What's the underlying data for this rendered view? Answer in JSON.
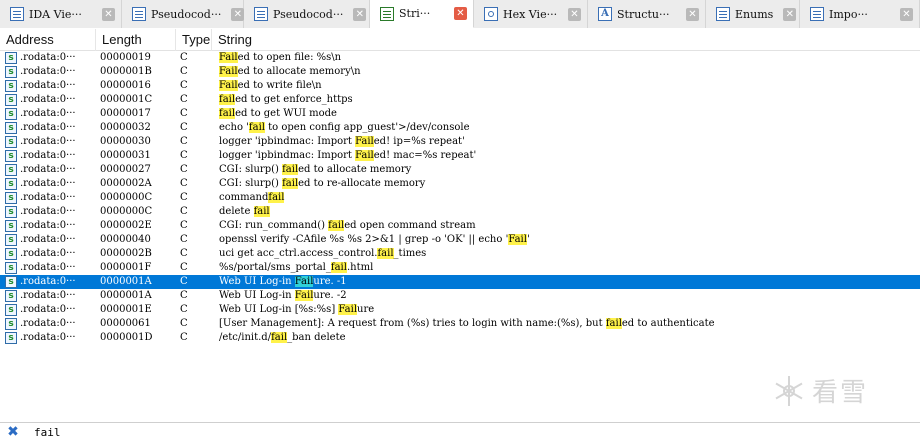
{
  "tabs": [
    {
      "label": "IDA Vie···",
      "icon": "ida-view-icon",
      "active": false
    },
    {
      "label": "Pseudocod···",
      "icon": "pseudocode-icon",
      "active": false
    },
    {
      "label": "Pseudocod···",
      "icon": "pseudocode-icon",
      "active": false
    },
    {
      "label": "Stri···",
      "icon": "strings-icon",
      "active": true
    },
    {
      "label": "Hex Vie···",
      "icon": "hex-view-icon",
      "active": false
    },
    {
      "label": "Structu···",
      "icon": "structures-icon",
      "active": false
    },
    {
      "label": "Enums",
      "icon": "enums-icon",
      "active": false
    },
    {
      "label": "Impo···",
      "icon": "imports-icon",
      "active": false
    }
  ],
  "columns": [
    "Address",
    "Length",
    "Type",
    "String"
  ],
  "rows": [
    {
      "address": ".rodata:0···",
      "length": "00000019",
      "type": "C",
      "pre": "",
      "match": "Fail",
      "post": "ed to open file: %s\\n"
    },
    {
      "address": ".rodata:0···",
      "length": "0000001B",
      "type": "C",
      "pre": "",
      "match": "Fail",
      "post": "ed to allocate memory\\n"
    },
    {
      "address": ".rodata:0···",
      "length": "00000016",
      "type": "C",
      "pre": "",
      "match": "Fail",
      "post": "ed to write file\\n"
    },
    {
      "address": ".rodata:0···",
      "length": "0000001C",
      "type": "C",
      "pre": "",
      "match": "fail",
      "post": "ed to get enforce_https"
    },
    {
      "address": ".rodata:0···",
      "length": "00000017",
      "type": "C",
      "pre": "",
      "match": "fail",
      "post": "ed to get WUI mode"
    },
    {
      "address": ".rodata:0···",
      "length": "00000032",
      "type": "C",
      "pre": "echo '",
      "match": "fail",
      "post": " to open config app_guest'>/dev/console"
    },
    {
      "address": ".rodata:0···",
      "length": "00000030",
      "type": "C",
      "pre": "logger 'ipbindmac: Import ",
      "match": "Fail",
      "post": "ed! ip=%s repeat'"
    },
    {
      "address": ".rodata:0···",
      "length": "00000031",
      "type": "C",
      "pre": "logger 'ipbindmac: Import ",
      "match": "Fail",
      "post": "ed! mac=%s repeat'"
    },
    {
      "address": ".rodata:0···",
      "length": "00000027",
      "type": "C",
      "pre": "CGI: slurp() ",
      "match": "fail",
      "post": "ed to allocate memory"
    },
    {
      "address": ".rodata:0···",
      "length": "0000002A",
      "type": "C",
      "pre": "CGI: slurp() ",
      "match": "fail",
      "post": "ed to re-allocate memory"
    },
    {
      "address": ".rodata:0···",
      "length": "0000000C",
      "type": "C",
      "pre": "command",
      "match": "fail",
      "post": ""
    },
    {
      "address": ".rodata:0···",
      "length": "0000000C",
      "type": "C",
      "pre": "delete ",
      "match": "fail",
      "post": ""
    },
    {
      "address": ".rodata:0···",
      "length": "0000002E",
      "type": "C",
      "pre": "CGI: run_command() ",
      "match": "fail",
      "post": "ed open command stream"
    },
    {
      "address": ".rodata:0···",
      "length": "00000040",
      "type": "C",
      "pre": "openssl verify -CAfile %s %s 2>&1 | grep -o 'OK' || echo '",
      "match": "Fail",
      "post": "'"
    },
    {
      "address": ".rodata:0···",
      "length": "0000002B",
      "type": "C",
      "pre": "uci get acc_ctrl.access_control.",
      "match": "fail",
      "post": "_times"
    },
    {
      "address": ".rodata:0···",
      "length": "0000001F",
      "type": "C",
      "pre": "%s/portal/sms_portal_",
      "match": "fail",
      "post": ".html"
    },
    {
      "address": ".rodata:0···",
      "length": "0000001A",
      "type": "C",
      "pre": "Web UI Log-in ",
      "match": "Fail",
      "post": "ure. -1",
      "selected": true
    },
    {
      "address": ".rodata:0···",
      "length": "0000001A",
      "type": "C",
      "pre": "Web UI Log-in ",
      "match": "Fail",
      "post": "ure. -2"
    },
    {
      "address": ".rodata:0···",
      "length": "0000001E",
      "type": "C",
      "pre": "Web UI Log-in [%s:%s] ",
      "match": "Fail",
      "post": "ure"
    },
    {
      "address": ".rodata:0···",
      "length": "00000061",
      "type": "C",
      "pre": "[User Management]: A request from (%s) tries to login with name:(%s), but ",
      "match": "fail",
      "post": "ed to authenticate"
    },
    {
      "address": ".rodata:0···",
      "length": "0000001D",
      "type": "C",
      "pre": "/etc/init.d/",
      "match": "fail",
      "post": "_ban delete"
    }
  ],
  "filter": {
    "value": "fail"
  },
  "watermark": {
    "text": "看雪"
  },
  "colors": {
    "selection": "#0078d7",
    "highlight": "#fff24a",
    "selected_highlight": "#2fd0d8"
  }
}
